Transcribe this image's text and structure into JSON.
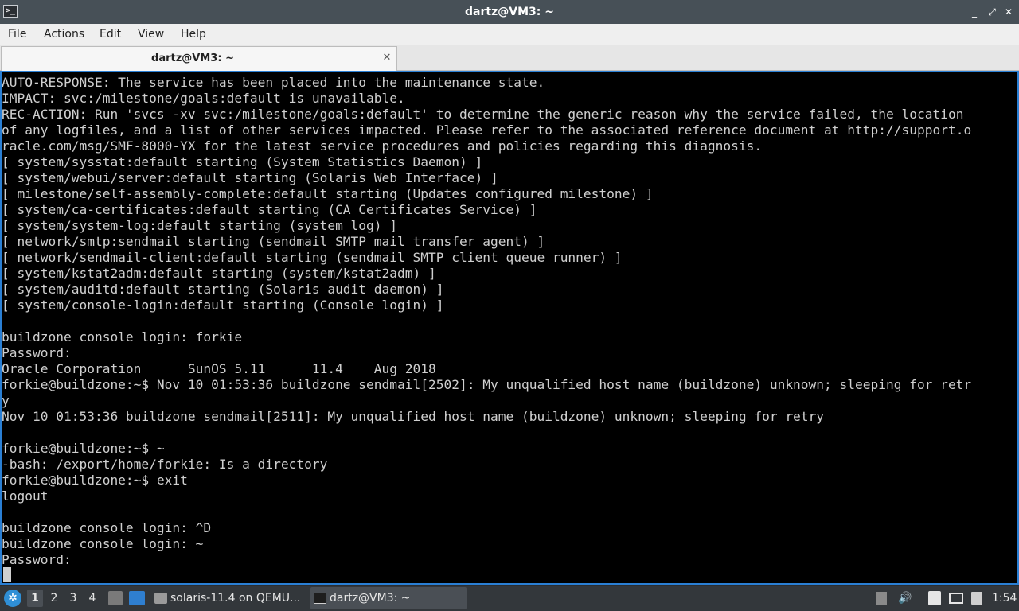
{
  "window": {
    "title": "dartz@VM3: ~",
    "buttons": {
      "minimize": "_",
      "maximize": "⤢",
      "close": "✕"
    }
  },
  "menubar": {
    "items": [
      {
        "label": "File"
      },
      {
        "label": "Actions"
      },
      {
        "label": "Edit"
      },
      {
        "label": "View"
      },
      {
        "label": "Help"
      }
    ]
  },
  "tabs": [
    {
      "label": "dartz@VM3: ~",
      "close": "✕",
      "active": true
    }
  ],
  "terminal": {
    "lines": [
      "AUTO-RESPONSE: The service has been placed into the maintenance state.",
      "IMPACT: svc:/milestone/goals:default is unavailable.",
      "REC-ACTION: Run 'svcs -xv svc:/milestone/goals:default' to determine the generic reason why the service failed, the location",
      "of any logfiles, and a list of other services impacted. Please refer to the associated reference document at http://support.o",
      "racle.com/msg/SMF-8000-YX for the latest service procedures and policies regarding this diagnosis.",
      "[ system/sysstat:default starting (System Statistics Daemon) ]",
      "[ system/webui/server:default starting (Solaris Web Interface) ]",
      "[ milestone/self-assembly-complete:default starting (Updates configured milestone) ]",
      "[ system/ca-certificates:default starting (CA Certificates Service) ]",
      "[ system/system-log:default starting (system log) ]",
      "[ network/smtp:sendmail starting (sendmail SMTP mail transfer agent) ]",
      "[ network/sendmail-client:default starting (sendmail SMTP client queue runner) ]",
      "[ system/kstat2adm:default starting (system/kstat2adm) ]",
      "[ system/auditd:default starting (Solaris audit daemon) ]",
      "[ system/console-login:default starting (Console login) ]",
      "",
      "buildzone console login: forkie",
      "Password:",
      "Oracle Corporation      SunOS 5.11      11.4    Aug 2018",
      "forkie@buildzone:~$ Nov 10 01:53:36 buildzone sendmail[2502]: My unqualified host name (buildzone) unknown; sleeping for retr",
      "y",
      "Nov 10 01:53:36 buildzone sendmail[2511]: My unqualified host name (buildzone) unknown; sleeping for retry",
      "",
      "forkie@buildzone:~$ ~",
      "-bash: /export/home/forkie: Is a directory",
      "forkie@buildzone:~$ exit",
      "logout",
      "",
      "buildzone console login: ^D",
      "buildzone console login: ~",
      "Password:"
    ]
  },
  "taskbar": {
    "desktops": [
      "1",
      "2",
      "3",
      "4"
    ],
    "active_desktop": "1",
    "tasks": [
      {
        "label": "solaris-11.4 on QEMU...",
        "icon": "virt-manager-icon"
      },
      {
        "label": "dartz@VM3: ~",
        "icon": "terminal-icon"
      }
    ],
    "clock": "1:54"
  },
  "colors": {
    "titlebar": "#475057",
    "terminal_bg": "#000000",
    "terminal_fg": "#cfcfcf",
    "terminal_border": "#2a7fd4",
    "taskbar": "#33373b"
  }
}
